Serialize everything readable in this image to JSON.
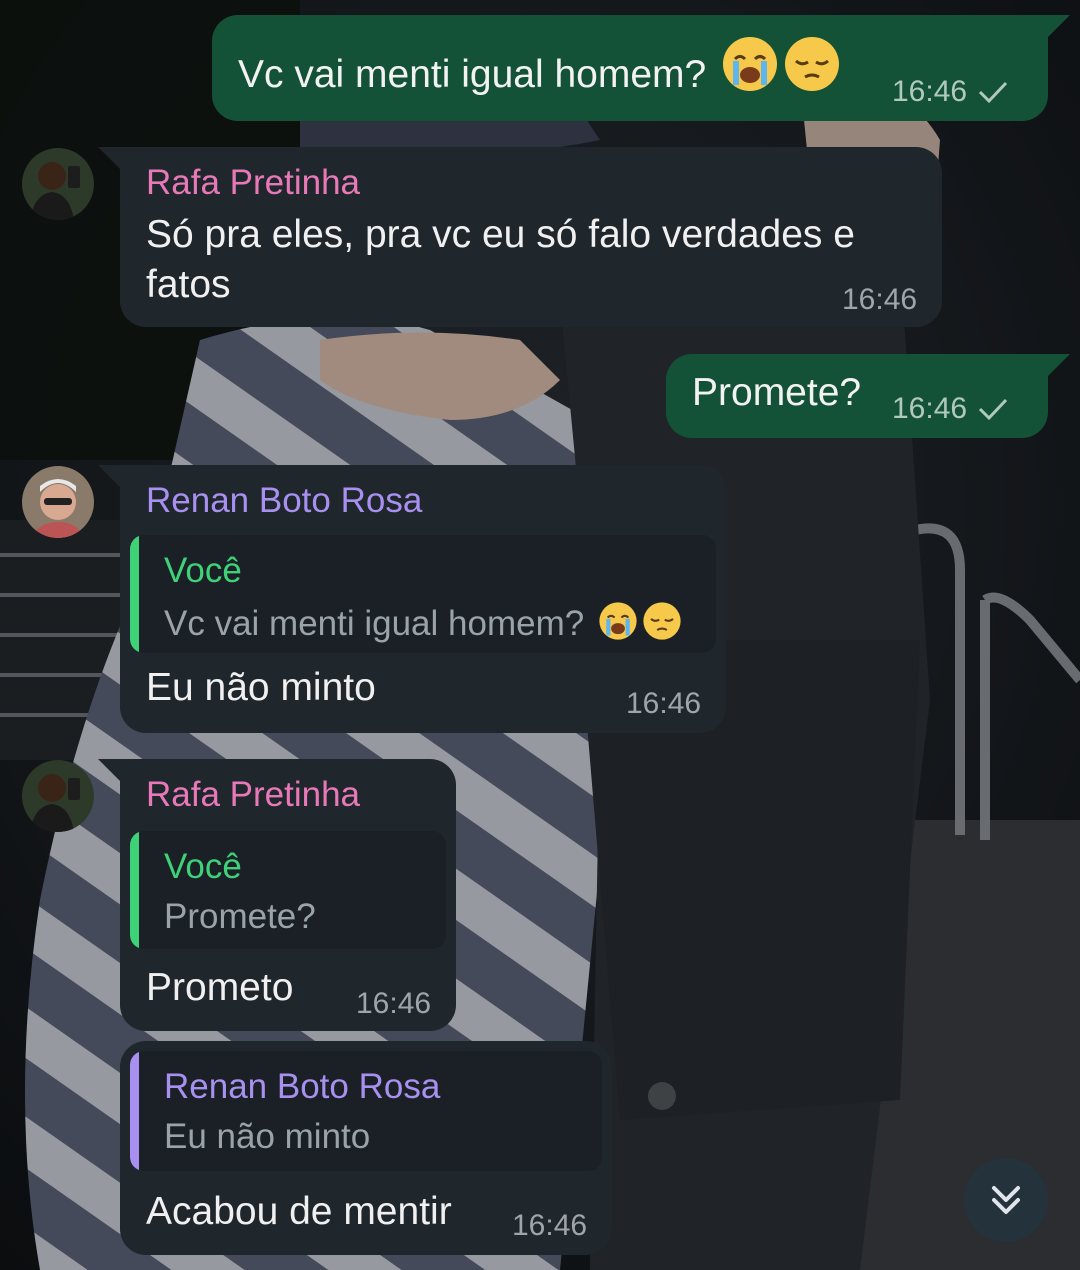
{
  "chat": {
    "messages": [
      {
        "type": "outgoing",
        "text": "Vc vai menti igual homem?",
        "emojis": [
          "loudly-crying-face",
          "pensive-face"
        ],
        "time": "16:46",
        "status": "sent-check"
      },
      {
        "type": "incoming",
        "sender": "Rafa Pretinha",
        "sender_color": "#e879b9",
        "text_line1": "Só pra eles, pra vc eu só falo verdades e",
        "text_line2": "fatos",
        "time": "16:46"
      },
      {
        "type": "outgoing",
        "text": "Promete?",
        "time": "16:46",
        "status": "sent-check"
      },
      {
        "type": "incoming",
        "sender": "Renan Boto Rosa",
        "sender_color": "#a890f0",
        "quote_name": "Você",
        "quote_text": "Vc vai menti igual homem?",
        "quote_emojis": [
          "loudly-crying-face",
          "pensive-face"
        ],
        "text": "Eu não minto",
        "time": "16:46"
      },
      {
        "type": "incoming",
        "sender": "Rafa Pretinha",
        "sender_color": "#e879b9",
        "quote_name": "Você",
        "quote_text": "Promete?",
        "text": "Prometo",
        "time": "16:46"
      },
      {
        "type": "incoming",
        "quote_name": "Renan Boto Rosa",
        "quote_text": "Eu não minto",
        "text": "Acabou de mentir",
        "time": "16:46"
      }
    ]
  },
  "colors": {
    "outgoing_bubble": "#145237",
    "incoming_bubble": "#1f262c",
    "quote_you": "#3fd178",
    "quote_renan": "#a890f0"
  },
  "scroll_button": {
    "icon": "double-chevron-down-icon"
  }
}
